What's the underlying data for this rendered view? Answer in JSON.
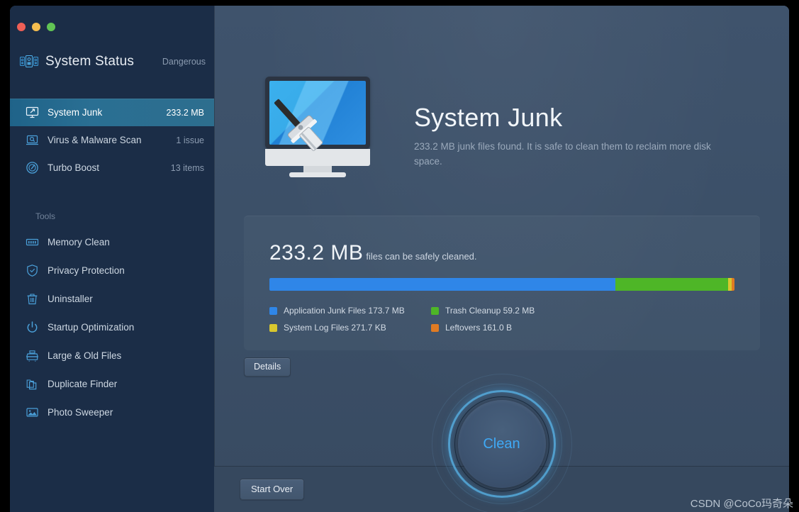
{
  "window": {
    "traffic_lights": [
      "close",
      "minimize",
      "maximize"
    ]
  },
  "sidebar": {
    "status": {
      "icon": "system-status-icon",
      "title": "System Status",
      "badge": "Dangerous"
    },
    "nav": [
      {
        "icon": "monitor-junk-icon",
        "label": "System Junk",
        "meta": "233.2 MB",
        "active": true
      },
      {
        "icon": "virus-scan-icon",
        "label": "Virus & Malware Scan",
        "meta": "1 issue",
        "active": false
      },
      {
        "icon": "turbo-boost-icon",
        "label": "Turbo Boost",
        "meta": "13 items",
        "active": false
      }
    ],
    "tools_header": "Tools",
    "tools": [
      {
        "icon": "memory-icon",
        "label": "Memory Clean"
      },
      {
        "icon": "shield-icon",
        "label": "Privacy Protection"
      },
      {
        "icon": "trash-icon",
        "label": "Uninstaller"
      },
      {
        "icon": "power-icon",
        "label": "Startup Optimization"
      },
      {
        "icon": "archive-icon",
        "label": "Large & Old Files"
      },
      {
        "icon": "copy-folder-icon",
        "label": "Duplicate Finder"
      },
      {
        "icon": "photo-icon",
        "label": "Photo Sweeper"
      }
    ]
  },
  "main": {
    "illustration": "monitor-with-squeegee-icon",
    "title": "System Junk",
    "subtitle": "233.2 MB junk files found.  It is safe to clean them to reclaim more disk space.",
    "card": {
      "amount": "233.2 MB",
      "amount_note": "files can be safely cleaned.",
      "segments": [
        {
          "label": "Application Junk Files 173.7 MB",
          "color": "#2f86e8",
          "percent": 74.4
        },
        {
          "label": "Trash Cleanup 59.2 MB",
          "color": "#4eb627",
          "percent": 24.3
        },
        {
          "label": "System Log Files 271.7 KB",
          "color": "#d8c72e",
          "percent": 0.7
        },
        {
          "label": "Leftovers 161.0 B",
          "color": "#e07b23",
          "percent": 0.6
        }
      ],
      "legend": [
        {
          "name": "Application Junk Files",
          "value": "173.7 MB",
          "label": "Application Junk Files 173.7 MB",
          "color": "#2f86e8"
        },
        {
          "name": "Trash Cleanup",
          "value": "59.2 MB",
          "label": "Trash Cleanup 59.2 MB",
          "color": "#4eb627"
        },
        {
          "name": "System Log Files",
          "value": "271.7 KB",
          "label": "System Log Files 271.7 KB",
          "color": "#d8c72e"
        },
        {
          "name": "Leftovers",
          "value": "161.0 B",
          "label": "Leftovers 161.0 B",
          "color": "#e07b23"
        }
      ]
    },
    "details_button": "Details",
    "start_over_button": "Start Over",
    "clean_button": "Clean"
  },
  "watermark": "CSDN @CoCo玛奇朵",
  "colors": {
    "sidebar_bg": "#1b2d47",
    "main_bg": "#3d5169",
    "active_nav": "#2a6f93",
    "accent_blue": "#3fa9f5",
    "icon_blue": "#3b9ad9"
  }
}
